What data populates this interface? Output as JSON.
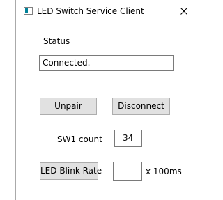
{
  "window": {
    "title": "LED Switch Service Client",
    "icon": "app-window-icon",
    "close_icon": "close-icon"
  },
  "status": {
    "label": "Status",
    "value": "Connected."
  },
  "buttons": {
    "unpair_label": "Unpair",
    "disconnect_label": "Disconnect",
    "led_blink_rate_label": "LED Blink Rate"
  },
  "sw1": {
    "label": "SW1 count",
    "value": "34"
  },
  "blink_rate": {
    "value": "",
    "unit": "x 100ms"
  },
  "colors": {
    "button_face": "#e1e1e1",
    "button_border": "#adadad",
    "field_border": "#7a7a7a",
    "icon_accent": "#008299"
  }
}
